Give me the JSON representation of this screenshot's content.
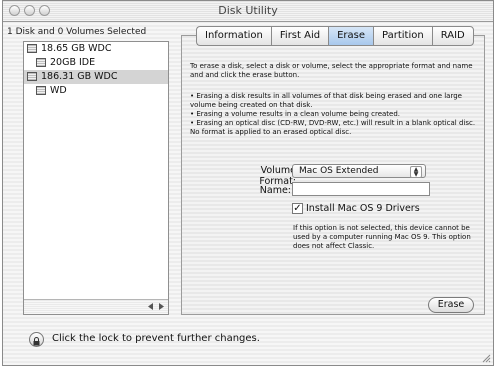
{
  "window": {
    "title": "Disk Utility"
  },
  "sidebar": {
    "header": "1 Disk and 0 Volumes Selected",
    "items": [
      {
        "label": "18.65 GB WDC",
        "level": 0,
        "selected": false
      },
      {
        "label": "20GB IDE",
        "level": 1,
        "selected": false
      },
      {
        "label": "186.31 GB WDC",
        "level": 0,
        "selected": true
      },
      {
        "label": "WD",
        "level": 1,
        "selected": false
      }
    ]
  },
  "tabs": [
    {
      "label": "Information",
      "active": false
    },
    {
      "label": "First Aid",
      "active": false
    },
    {
      "label": "Erase",
      "active": true
    },
    {
      "label": "Partition",
      "active": false
    },
    {
      "label": "RAID",
      "active": false
    }
  ],
  "erase": {
    "intro": "To erase a disk, select a disk or volume, select the appropriate format and name and and click the erase button.",
    "bullets": [
      "• Erasing a disk results in all volumes of that disk being erased and one large volume being created on that disk.",
      "• Erasing a volume results in a clean volume being created.",
      "• Erasing an optical disc (CD-RW, DVD-RW, etc.) will result in a blank optical disc. No format is applied to an erased optical disc."
    ],
    "volume_format_label": "Volume Format:",
    "volume_format_value": "Mac OS Extended",
    "name_label": "Name:",
    "name_value": "",
    "install_label": "Install Mac OS 9 Drivers",
    "install_checked": true,
    "note": "If this option is not selected, this device cannot be used by a computer running Mac OS 9.  This option does not affect Classic.",
    "erase_button": "Erase"
  },
  "footer": {
    "lock_text": "Click the lock to prevent further changes."
  },
  "colors": {
    "active_tab": "#a8c8ec",
    "selected_row": "#d4d4d4"
  }
}
